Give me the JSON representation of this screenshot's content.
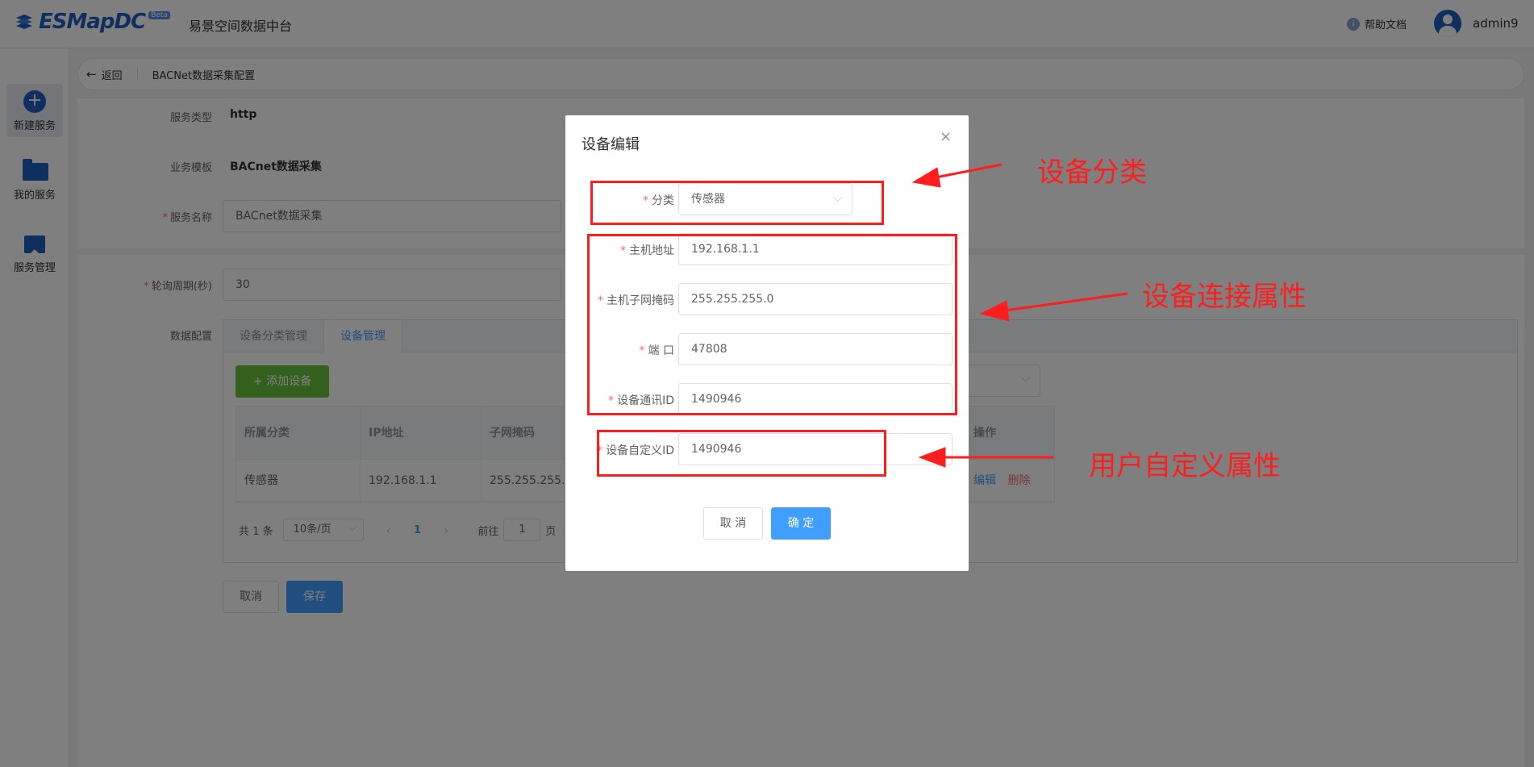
{
  "header": {
    "logo_text": "ESMapDC",
    "logo_badge": "Beta",
    "app_title": "易景空间数据中台",
    "help_label": "帮助文档",
    "user_name": "admin9"
  },
  "sidebar": {
    "items": [
      {
        "label": "新建服务"
      },
      {
        "label": "我的服务"
      },
      {
        "label": "服务管理"
      }
    ]
  },
  "breadcrumb": {
    "back_label": "返回",
    "page_title": "BACNet数据采集配置"
  },
  "form": {
    "service_type_label": "服务类型",
    "service_type_value": "http",
    "template_label": "业务模板",
    "template_value": "BACnet数据采集",
    "service_name_label": "服务名称",
    "service_name_value": "BACnet数据采集",
    "poll_label": "轮询周期(秒)",
    "poll_value": "30",
    "data_config_label": "数据配置",
    "cancel_label": "取消",
    "save_label": "保存"
  },
  "tabs": [
    {
      "label": "设备分类管理"
    },
    {
      "label": "设备管理"
    }
  ],
  "device_table": {
    "add_label": "+ 添加设备",
    "headers": [
      "所属分类",
      "IP地址",
      "子网掩码",
      "操作"
    ],
    "rows": [
      {
        "category": "传感器",
        "ip": "192.168.1.1",
        "mask": "255.255.255.0",
        "edit": "编辑",
        "delete": "删除"
      }
    ]
  },
  "pager": {
    "total": "共 1 条",
    "page_size": "10条/页",
    "prev": "‹",
    "current": "1",
    "next": "›",
    "goto_label": "前往",
    "goto_value": "1",
    "page_suffix": "页"
  },
  "dialog": {
    "title": "设备编辑",
    "close": "×",
    "category_label": "分类",
    "category_value": "传感器",
    "host_label": "主机地址",
    "host_value": "192.168.1.1",
    "mask_label": "主机子网掩码",
    "mask_value": "255.255.255.0",
    "port_label": "端 口",
    "port_value": "47808",
    "comm_id_label": "设备通讯ID",
    "comm_id_value": "1490946",
    "custom_id_label": "设备自定义ID",
    "custom_id_value": "1490946",
    "cancel_label": "取 消",
    "ok_label": "确 定"
  },
  "annotations": {
    "category": "设备分类",
    "connection": "设备连接属性",
    "custom": "用户自定义属性",
    "color": "#ff1e1e"
  },
  "colors": {
    "primary": "#409eff",
    "brand": "#1f5fbf",
    "success": "#67c23a",
    "danger": "#f56c6c"
  }
}
